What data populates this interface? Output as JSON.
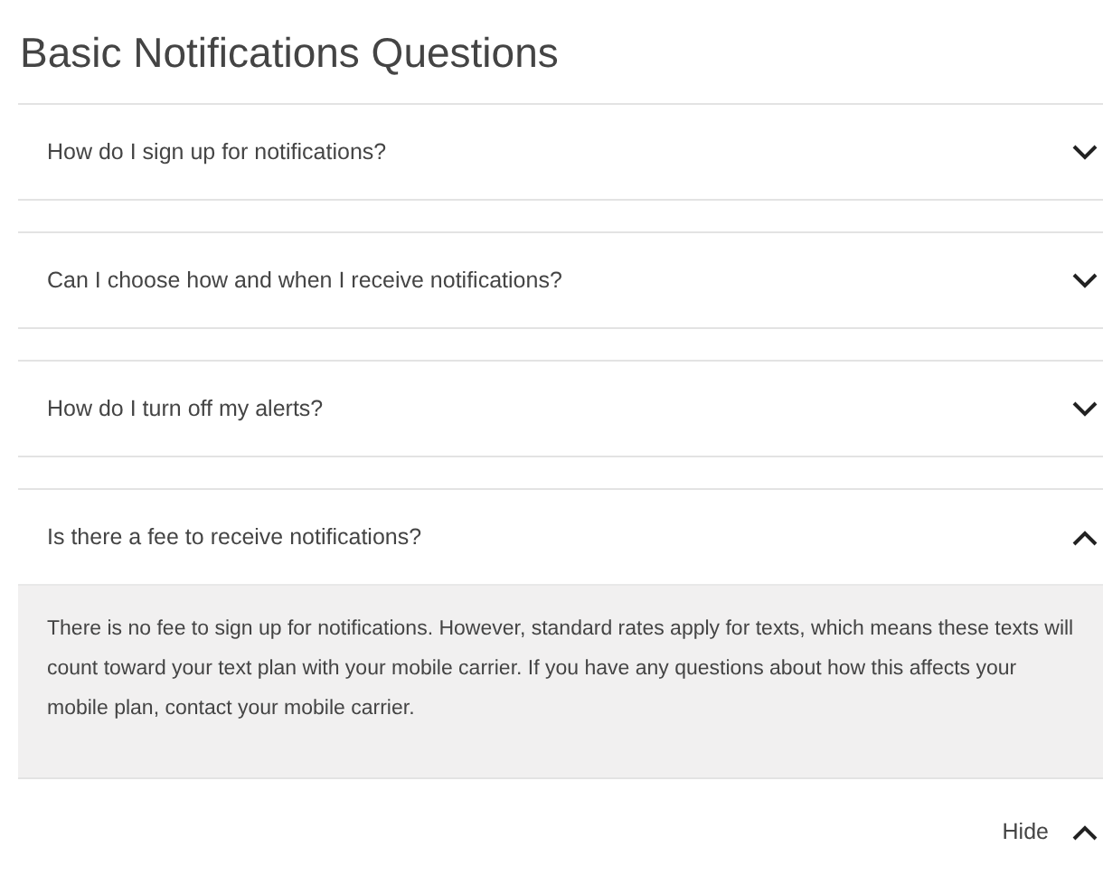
{
  "title": "Basic Notifications Questions",
  "questions": [
    {
      "question": "How do I sign up for notifications?",
      "expanded": false
    },
    {
      "question": "Can I choose how and when I receive notifications?",
      "expanded": false
    },
    {
      "question": "How do I turn off my alerts?",
      "expanded": false
    },
    {
      "question": "Is there a fee to receive notifications?",
      "expanded": true,
      "answer": "There is no fee to sign up for notifications. However, standard rates apply for texts, which means these texts will count toward your text plan with your mobile carrier. If you have any questions about how this affects your mobile plan, contact your mobile carrier."
    }
  ],
  "hide_link": "Hide"
}
